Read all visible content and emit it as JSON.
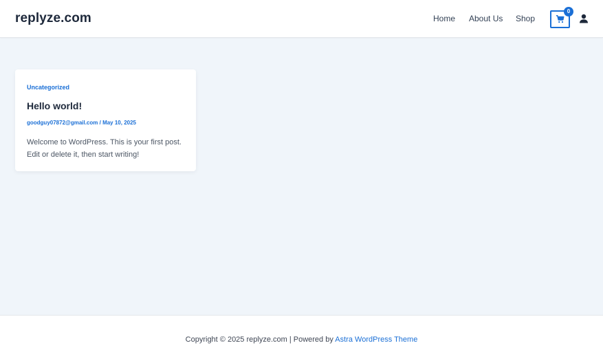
{
  "header": {
    "site_title": "replyze.com",
    "nav": {
      "home": "Home",
      "about": "About Us",
      "shop": "Shop"
    },
    "cart_count": "0",
    "cart_icon": "cart-icon",
    "user_icon": "user-icon"
  },
  "post": {
    "category": "Uncategorized",
    "title": "Hello world!",
    "author": "goodguy07872@gmail.com",
    "separator": " / ",
    "date": "May 10, 2025",
    "excerpt": "Welcome to WordPress. This is your first post. Edit or delete it, then start writing!"
  },
  "footer": {
    "copyright_prefix": "Copyright © 2025 replyze.com | Powered by ",
    "theme_link": "Astra WordPress Theme"
  },
  "colors": {
    "accent": "#1a6fd6",
    "background": "#f0f5fa"
  }
}
